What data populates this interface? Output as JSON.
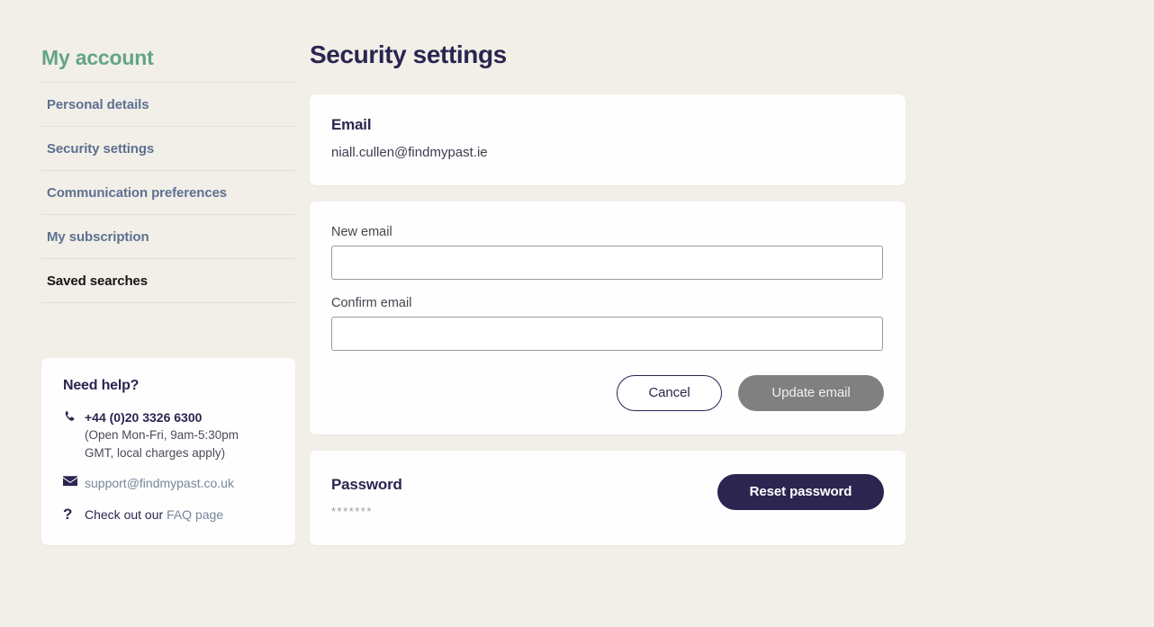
{
  "sidebar": {
    "title": "My account",
    "items": [
      {
        "label": "Personal details",
        "active": false
      },
      {
        "label": "Security settings",
        "active": false
      },
      {
        "label": "Communication preferences",
        "active": false
      },
      {
        "label": "My subscription",
        "active": false
      },
      {
        "label": "Saved searches",
        "active": true
      }
    ],
    "help": {
      "title": "Need help?",
      "phone_icon": "phone-icon",
      "phone": "+44 (0)20 3326 6300",
      "hours": "(Open Mon-Fri, 9am-5:30pm GMT, local charges apply)",
      "email_icon": "envelope-icon",
      "email": "support@findmypast.co.uk",
      "faq_icon": "question-mark-icon",
      "faq_prefix": "Check out our ",
      "faq_link": "FAQ page"
    }
  },
  "main": {
    "page_title": "Security settings",
    "email_card": {
      "heading": "Email",
      "value": "niall.cullen@findmypast.ie"
    },
    "email_form": {
      "new_email_label": "New email",
      "new_email_value": "",
      "new_email_placeholder": "",
      "confirm_email_label": "Confirm email",
      "confirm_email_value": "",
      "confirm_email_placeholder": "",
      "cancel_label": "Cancel",
      "update_label": "Update email"
    },
    "password_card": {
      "heading": "Password",
      "masked_value": "*******",
      "reset_label": "Reset password"
    }
  },
  "colors": {
    "page_background": "#f2efe9",
    "card_background": "#fffefe",
    "accent_green": "#63a489",
    "nav_link": "#5c7190",
    "nav_active": "#151515",
    "navy": "#2b2550",
    "disabled_gray": "#808080"
  }
}
